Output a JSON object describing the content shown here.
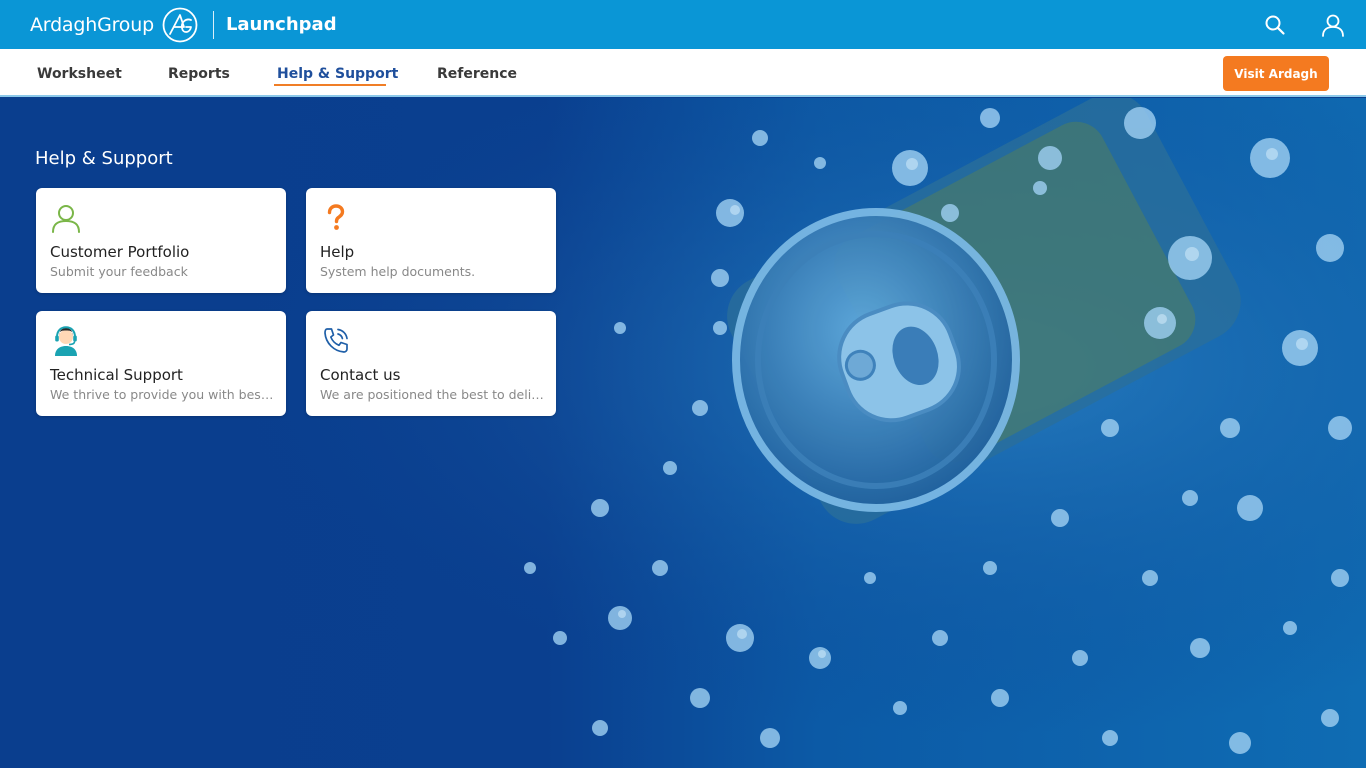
{
  "header": {
    "brand_name": "ArdaghGroup",
    "app_name": "Launchpad"
  },
  "nav": {
    "items": [
      {
        "label": "Worksheet"
      },
      {
        "label": "Reports"
      },
      {
        "label": "Help & Support",
        "active": true
      },
      {
        "label": "Reference"
      }
    ],
    "cta_label": "Visit Ardagh"
  },
  "main": {
    "title": "Help & Support",
    "cards": [
      {
        "title": "Customer Portfolio",
        "subtitle": "Submit your feedback",
        "icon": "user-outline-icon"
      },
      {
        "title": "Help",
        "subtitle": "System help documents.",
        "icon": "question-mark-icon"
      },
      {
        "title": "Technical Support",
        "subtitle": "We thrive to provide you with best...",
        "icon": "support-agent-icon"
      },
      {
        "title": "Contact us",
        "subtitle": "We are positioned the best to deliver.",
        "icon": "phone-ringing-icon"
      }
    ]
  },
  "colors": {
    "topbar": "#0a96d6",
    "accent": "#f47a20",
    "active_nav": "#1f4f9c",
    "background": "#0a3f8f"
  }
}
